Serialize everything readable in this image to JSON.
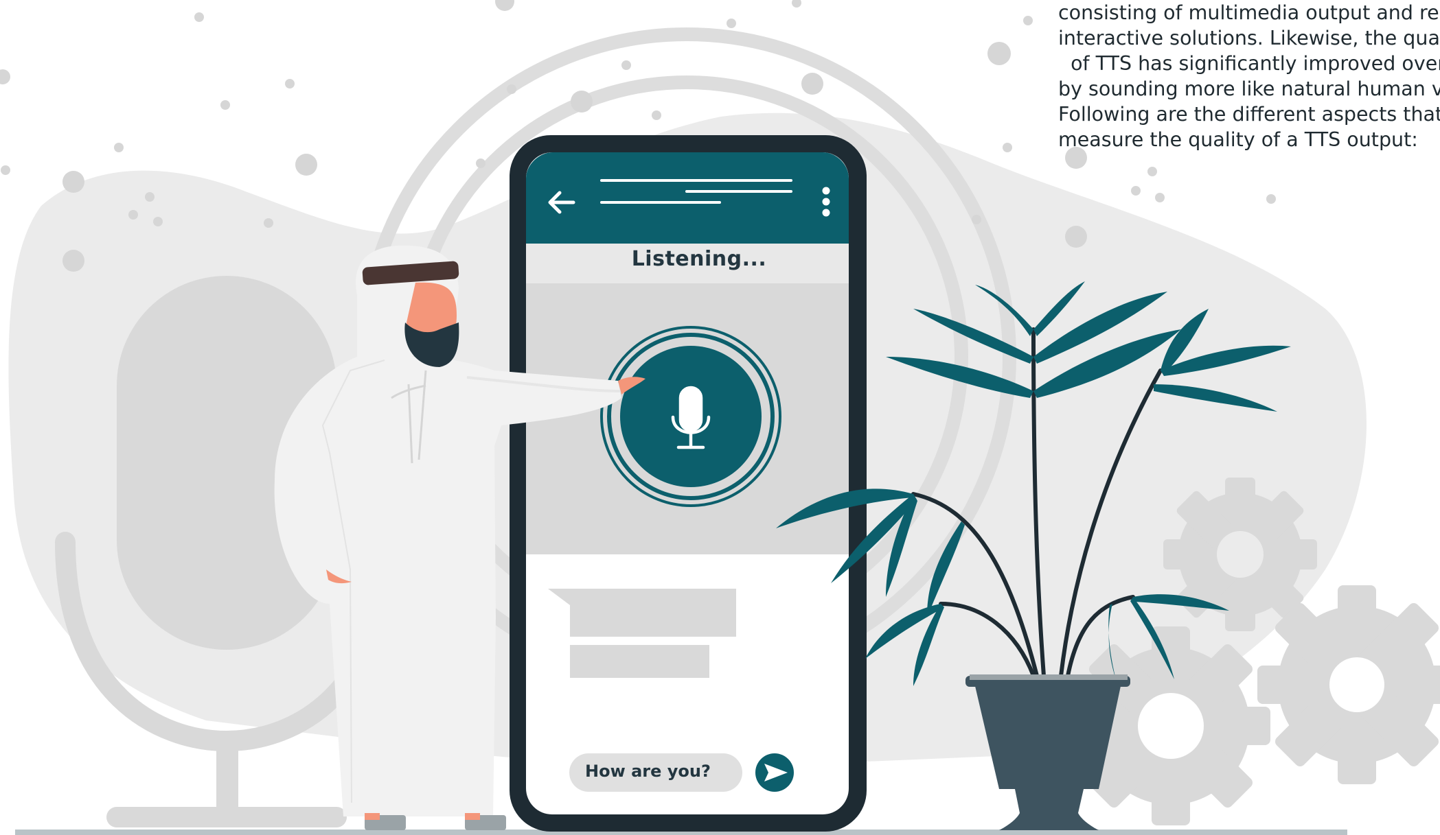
{
  "paragraph": {
    "lines": [
      "consisting of multimedia output and rele",
      "interactive solutions. Likewise, the qualit",
      "  of TTS has significantly improved over t",
      "by sounding more like natural human voi",
      "Following are the different aspects that",
      "measure the quality of a TTS output:"
    ]
  },
  "phone": {
    "status": "Listening...",
    "message_input": "How are you?"
  },
  "colors": {
    "teal": "#0c5f6c",
    "dark": "#1e2b33",
    "blob": "#ebebeb",
    "gray": "#d9d9d9",
    "skin": "#f4967a",
    "beard": "#233640",
    "pot": "#3e5460"
  },
  "icons": [
    "back-arrow-icon",
    "kebab-menu-icon",
    "microphone-icon",
    "send-icon",
    "gear-icon"
  ]
}
